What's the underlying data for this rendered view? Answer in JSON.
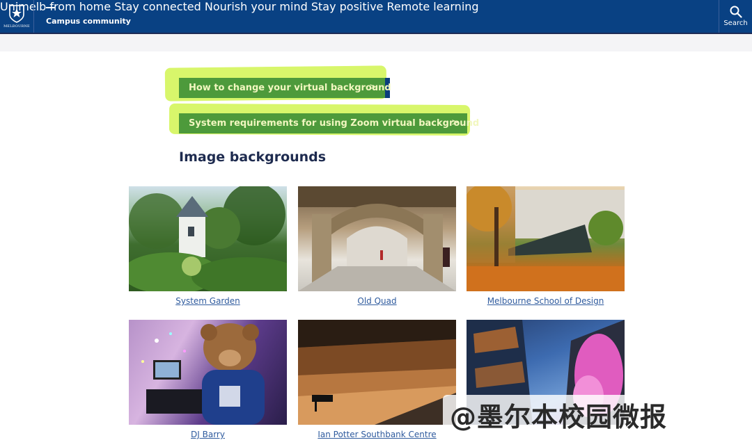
{
  "header": {
    "logo_text": "MELBOURNE",
    "site_title": "Campus community",
    "nav": [
      {
        "label": "Unimelb from home"
      },
      {
        "label": "Stay connected"
      },
      {
        "label": "Nourish your mind"
      },
      {
        "label": "Stay positive"
      },
      {
        "label": "Remote learning"
      }
    ],
    "search_label": "Search"
  },
  "buttons": [
    {
      "label": "How to change your virtual background",
      "chevron": ">"
    },
    {
      "label": "System requirements for using Zoom virtual background",
      "chevron": ">"
    }
  ],
  "section_title": "Image backgrounds",
  "images": [
    {
      "caption": "System Garden"
    },
    {
      "caption": "Old Quad"
    },
    {
      "caption": "Melbourne School of Design"
    },
    {
      "caption": "DJ Barry"
    },
    {
      "caption": "Ian Potter Southbank Centre"
    },
    {
      "caption": ""
    }
  ],
  "watermark": "@墨尔本校园微报",
  "colors": {
    "header_bg": "#094183",
    "button_bg": "#4d9a3b",
    "highlight": "#d6f563",
    "link": "#2f5b9e"
  }
}
